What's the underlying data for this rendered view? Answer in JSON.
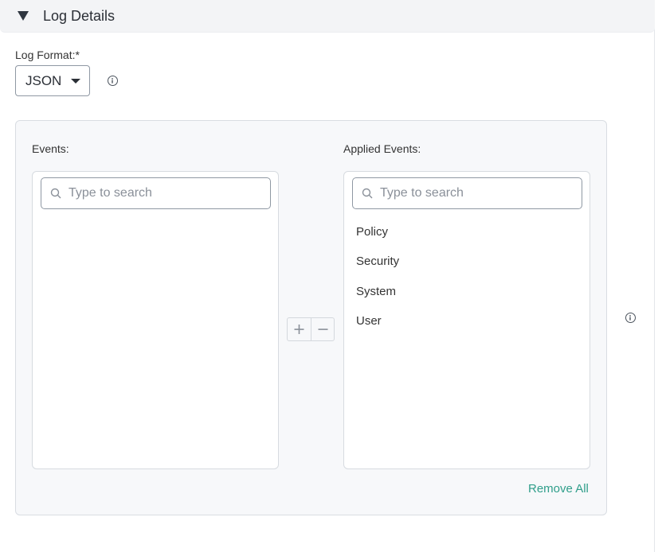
{
  "section": {
    "title": "Log Details"
  },
  "log_format": {
    "label": "Log Format:*",
    "value": "JSON"
  },
  "events": {
    "label": "Events:",
    "search_placeholder": "Type to search",
    "items": []
  },
  "applied_events": {
    "label": "Applied Events:",
    "search_placeholder": "Type to search",
    "items": [
      "Policy",
      "Security",
      "System",
      "User"
    ]
  },
  "remove_all_label": "Remove All",
  "colors": {
    "accent": "#2f9e8a",
    "panel_bg": "#f7f8fa",
    "header_bg": "#f3f4f6"
  }
}
